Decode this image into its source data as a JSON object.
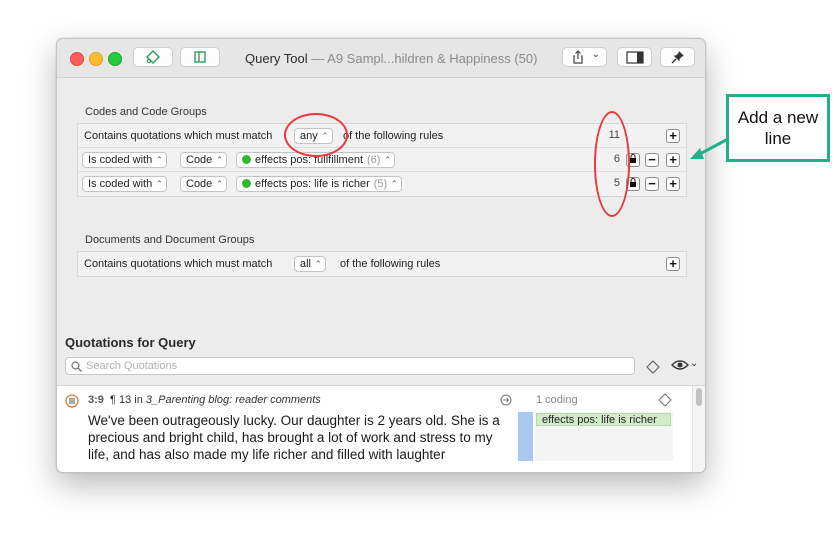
{
  "window": {
    "title": "Query Tool",
    "subtitle": "— A9 Sampl...hildren & Happiness (50)"
  },
  "codes_section": {
    "label": "Codes and Code Groups",
    "header_row": {
      "prefix": "Contains quotations which must match",
      "match_value": "any",
      "suffix": "of the following rules",
      "count": "11"
    },
    "rules": [
      {
        "operator": "Is coded with",
        "type": "Code",
        "code": "effects pos: fullfillment",
        "code_count": "(6)",
        "count": "6"
      },
      {
        "operator": "Is coded with",
        "type": "Code",
        "code": "effects pos: life is richer",
        "code_count": "(5)",
        "count": "5"
      }
    ]
  },
  "documents_section": {
    "label": "Documents and Document Groups",
    "header_row": {
      "prefix": "Contains quotations which must match",
      "match_value": "all",
      "suffix": "of the following rules"
    }
  },
  "quotations": {
    "heading": "Quotations for Query",
    "search_placeholder": "Search Quotations",
    "items": [
      {
        "id": "3:9",
        "paragraph": "¶ 13 in",
        "document": "3_Parenting blog: reader comments",
        "text": "We've been outrageously lucky. Our daughter is 2 years old. She is a precious and bright child, has brought a lot of work and stress to my life, and has also made my life richer and filled with laughter",
        "coding_count": "1 coding",
        "code_tag": "effects pos: life is richer"
      }
    ]
  },
  "annotation": {
    "callout_text": "Add a new line"
  },
  "colors": {
    "callout_border": "#22b08a",
    "red_circle": "#e8393c",
    "code_dot": "#2eb82e",
    "code_tag_bg": "#d2ebc9",
    "coding_bar": "#a9c8f0"
  }
}
